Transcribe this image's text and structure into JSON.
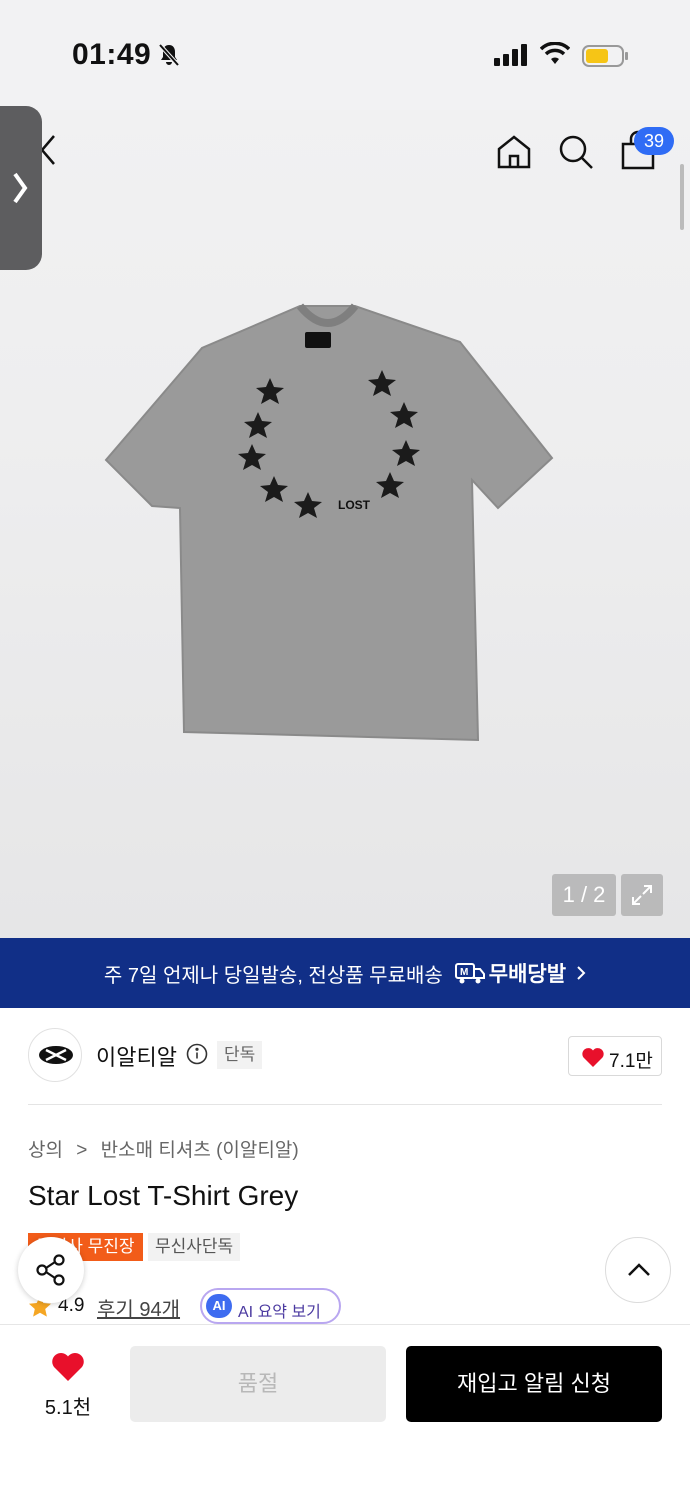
{
  "status_bar": {
    "time": "01:49"
  },
  "nav": {
    "cart_count": "39"
  },
  "gallery": {
    "page_indicator": "1 / 2",
    "print_text": "LOST"
  },
  "banner": {
    "text": "주 7일 언제나 당일발송, 전상품 무료배송",
    "brand": "무배당발"
  },
  "brand": {
    "name": "이알티알",
    "tag": "단독",
    "likes": "7.1만"
  },
  "product": {
    "breadcrumb": [
      "상의",
      "반소매 티셔츠 (이알티알)"
    ],
    "title": "Star Lost T-Shirt Grey",
    "tags": [
      "무신사 무진장",
      "무신사단독"
    ],
    "rating": "4.9",
    "reviews": "후기 94개",
    "ai_label": "AI",
    "ai_summary": "AI 요약 보기"
  },
  "bottom_bar": {
    "wish_count": "5.1천",
    "soldout_label": "품절",
    "restock_label": "재입고 알림 신청"
  },
  "colors": {
    "banner_bg": "#112f87",
    "badge_blue": "#2f6cf5",
    "tag_orange": "#f25c19",
    "heart_red": "#e8102b"
  }
}
